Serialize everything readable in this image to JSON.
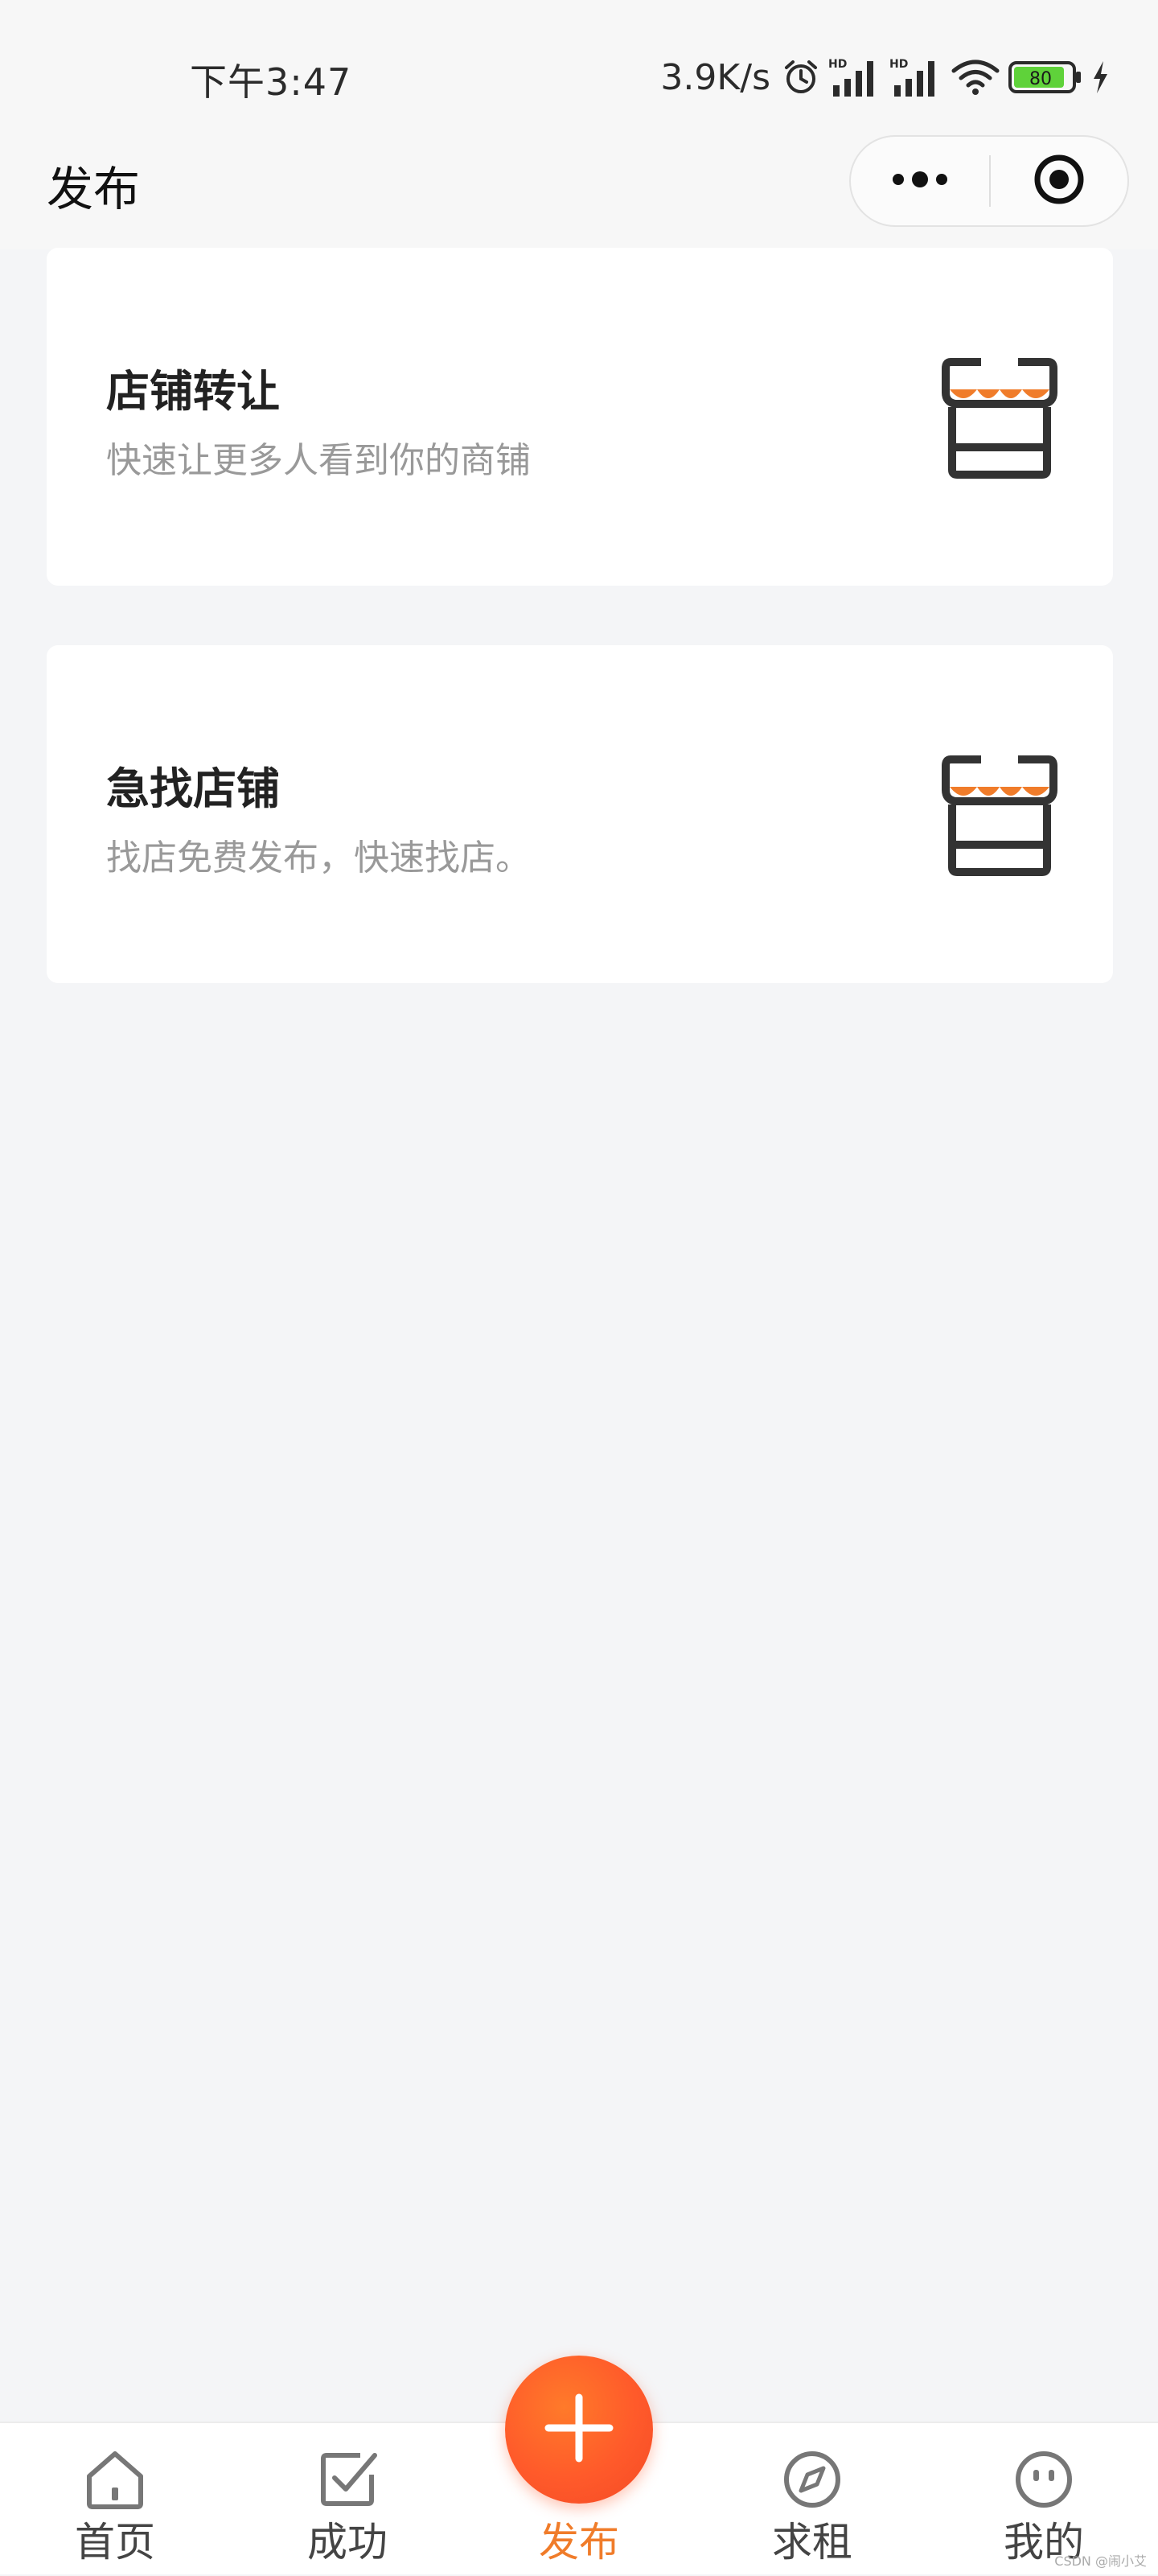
{
  "status_bar": {
    "time": "下午3:47",
    "speed": "3.9K/s",
    "battery": "80",
    "icons": [
      "alarm-icon",
      "hd-signal-icon",
      "hd-signal-icon",
      "wifi-icon",
      "battery-icon",
      "charging-icon"
    ]
  },
  "header": {
    "title": "发布",
    "more_icon": "more-dots-icon",
    "close_icon": "target-icon"
  },
  "cards": [
    {
      "title": "店铺转让",
      "subtitle": "快速让更多人看到你的商铺",
      "icon": "shop-icon"
    },
    {
      "title": "急找店铺",
      "subtitle": "找店免费发布，快速找店。",
      "icon": "shop-icon"
    }
  ],
  "tabbar": {
    "items": [
      {
        "label": "首页",
        "icon": "home-icon"
      },
      {
        "label": "成功",
        "icon": "check-square-icon"
      },
      {
        "label": "发布",
        "icon": "plus-icon",
        "active": true
      },
      {
        "label": "求租",
        "icon": "compass-icon"
      },
      {
        "label": "我的",
        "icon": "face-icon"
      }
    ]
  },
  "colors": {
    "accent": "#f07c2a",
    "fab": "#ff5a2a",
    "background": "#f4f5f7",
    "card": "#ffffff",
    "subtext": "#999999"
  },
  "watermark": "CSDN @闹小艾"
}
